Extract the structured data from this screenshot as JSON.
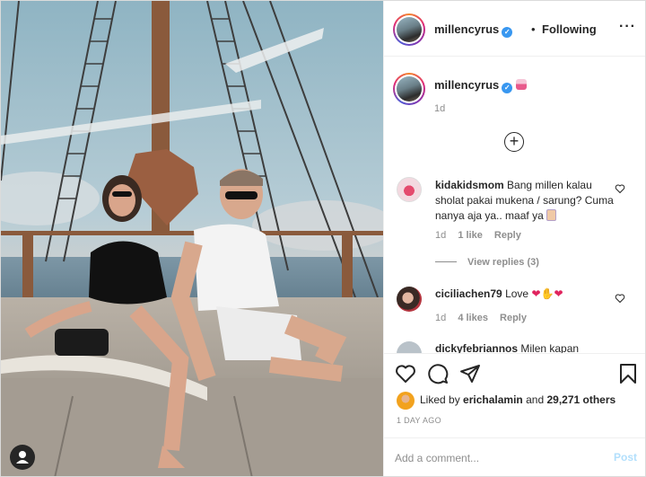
{
  "header": {
    "username": "millencyrus",
    "separator": "•",
    "follow_status": "Following",
    "more_icon": "more-horizontal-icon",
    "verified_icon": "verified-badge-icon"
  },
  "caption": {
    "username": "millencyrus",
    "emoji": "birthday-cake-emoji",
    "time": "1d"
  },
  "load_more_icon": "plus-circle-icon",
  "comments": [
    {
      "username": "kidakidsmom",
      "text": "Bang millen kalau sholat pakai mukena / sarung? Cuma nanya aja ya.. maaf ya",
      "emoji": "folded-hands-emoji",
      "time": "1d",
      "likes": "1 like",
      "reply": "Reply",
      "view_replies": "View replies (3)"
    },
    {
      "username": "ciciliachen79",
      "text": "Love",
      "emojis": [
        "❤",
        "✋",
        "❤"
      ],
      "time": "1d",
      "likes": "4 likes",
      "reply": "Reply"
    },
    {
      "username": "dickyfebriannos",
      "text": "Milen kapan"
    }
  ],
  "actions": {
    "like_icon": "heart-icon",
    "comment_icon": "comment-icon",
    "share_icon": "paper-plane-icon",
    "save_icon": "bookmark-icon"
  },
  "likes": {
    "prefix": "Liked by",
    "user": "erichalamin",
    "suffix": "and",
    "others": "29,271 others"
  },
  "date": "1 DAY AGO",
  "add_comment": {
    "placeholder": "Add a comment...",
    "post_label": "Post"
  },
  "colors": {
    "link_blue": "#3897f0",
    "post_disabled": "#b2dffc",
    "heart_red": "#e0245e",
    "muted": "#8e8e8e"
  }
}
